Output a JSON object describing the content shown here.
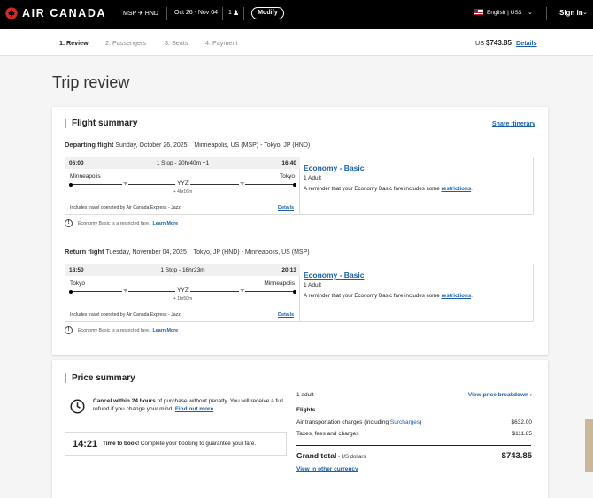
{
  "header": {
    "brand": "AIR CANADA",
    "route": "MSP ✈ HND",
    "dates": "Oct 26 - Nov 04",
    "passengers": "1",
    "modify_label": "Modify",
    "language": "English | US$",
    "signin_label": "Sign in",
    "brand_color": "#d52b1e"
  },
  "steps": [
    {
      "label": "1. Review",
      "active": true
    },
    {
      "label": "2. Passengers"
    },
    {
      "label": "3. Seats"
    },
    {
      "label": "4. Payment"
    }
  ],
  "topbar_total": {
    "currency": "US",
    "amount": "$743.85",
    "details_label": "Details"
  },
  "page_title": "Trip review",
  "flight_summary": {
    "heading": "Flight summary",
    "share_label": "Share itinerary",
    "legs": [
      {
        "label": "Departing flight",
        "date": "Sunday, October 26, 2025",
        "route": "Minneapolis, US (MSP) - Tokyo, JP (HND)",
        "depart_time": "06:00",
        "stops": "1 Stop - 20hr40m +1",
        "arrive_time": "16:40",
        "origin_city": "Minneapolis",
        "dest_city": "Tokyo",
        "stop_code": "YYZ",
        "layover": "+ 4hr16m",
        "operated_by": "Includes travel operated by Air Canada Express - Jazz.",
        "details_label": "Details",
        "fare_name": "Economy - Basic",
        "fare_pax": "1 Adult",
        "fare_reminder": "A reminder that your Economy Basic fare includes some",
        "fare_link": "restrictions",
        "fare_end": ".",
        "restricted_note": "Economy Basic is a restricted fare.",
        "learn_more": "Learn More"
      },
      {
        "label": "Return flight",
        "date": "Tuesday, November 04, 2025",
        "route": "Tokyo, JP (HND) - Minneapolis, US (MSP)",
        "depart_time": "18:50",
        "stops": "1 Stop - 16hr23m",
        "arrive_time": "20:13",
        "origin_city": "Tokyo",
        "dest_city": "Minneapolis",
        "stop_code": "YYZ",
        "layover": "+ 1hr50m",
        "operated_by": "Includes travel operated by Air Canada Express - Jazz.",
        "details_label": "Details",
        "fare_name": "Economy - Basic",
        "fare_pax": "1 Adult",
        "fare_reminder": "A reminder that your Economy Basic fare includes some",
        "fare_link": "restrictions",
        "fare_end": ".",
        "restricted_note": "Economy Basic is a restricted fare.",
        "learn_more": "Learn More"
      }
    ]
  },
  "price_summary": {
    "heading": "Price summary",
    "cancel_bold": "Cancel within 24 hours",
    "cancel_text": " of purchase without penalty. You will receive a full refund if you change your mind.",
    "find_out_more": "Find out more",
    "timer": "14:21",
    "timer_bold": "Time to book!",
    "timer_text": " Complete your booking to guarantee your fare.",
    "adult_label": "1 adult",
    "breakdown_label": "View price breakdown",
    "flights_label": "Flights",
    "air_transport_label": "Air transportation charges (including",
    "surcharges_link": "Surcharges",
    "air_transport_end": ")",
    "air_transport_value": "$632.00",
    "taxes_label": "Taxes, fees and charges",
    "taxes_value": "$111.85",
    "grand_total_label": "Grand total",
    "grand_total_currency": " - US dollars",
    "grand_total_value": "$743.85",
    "other_currency": "View in other currency"
  }
}
